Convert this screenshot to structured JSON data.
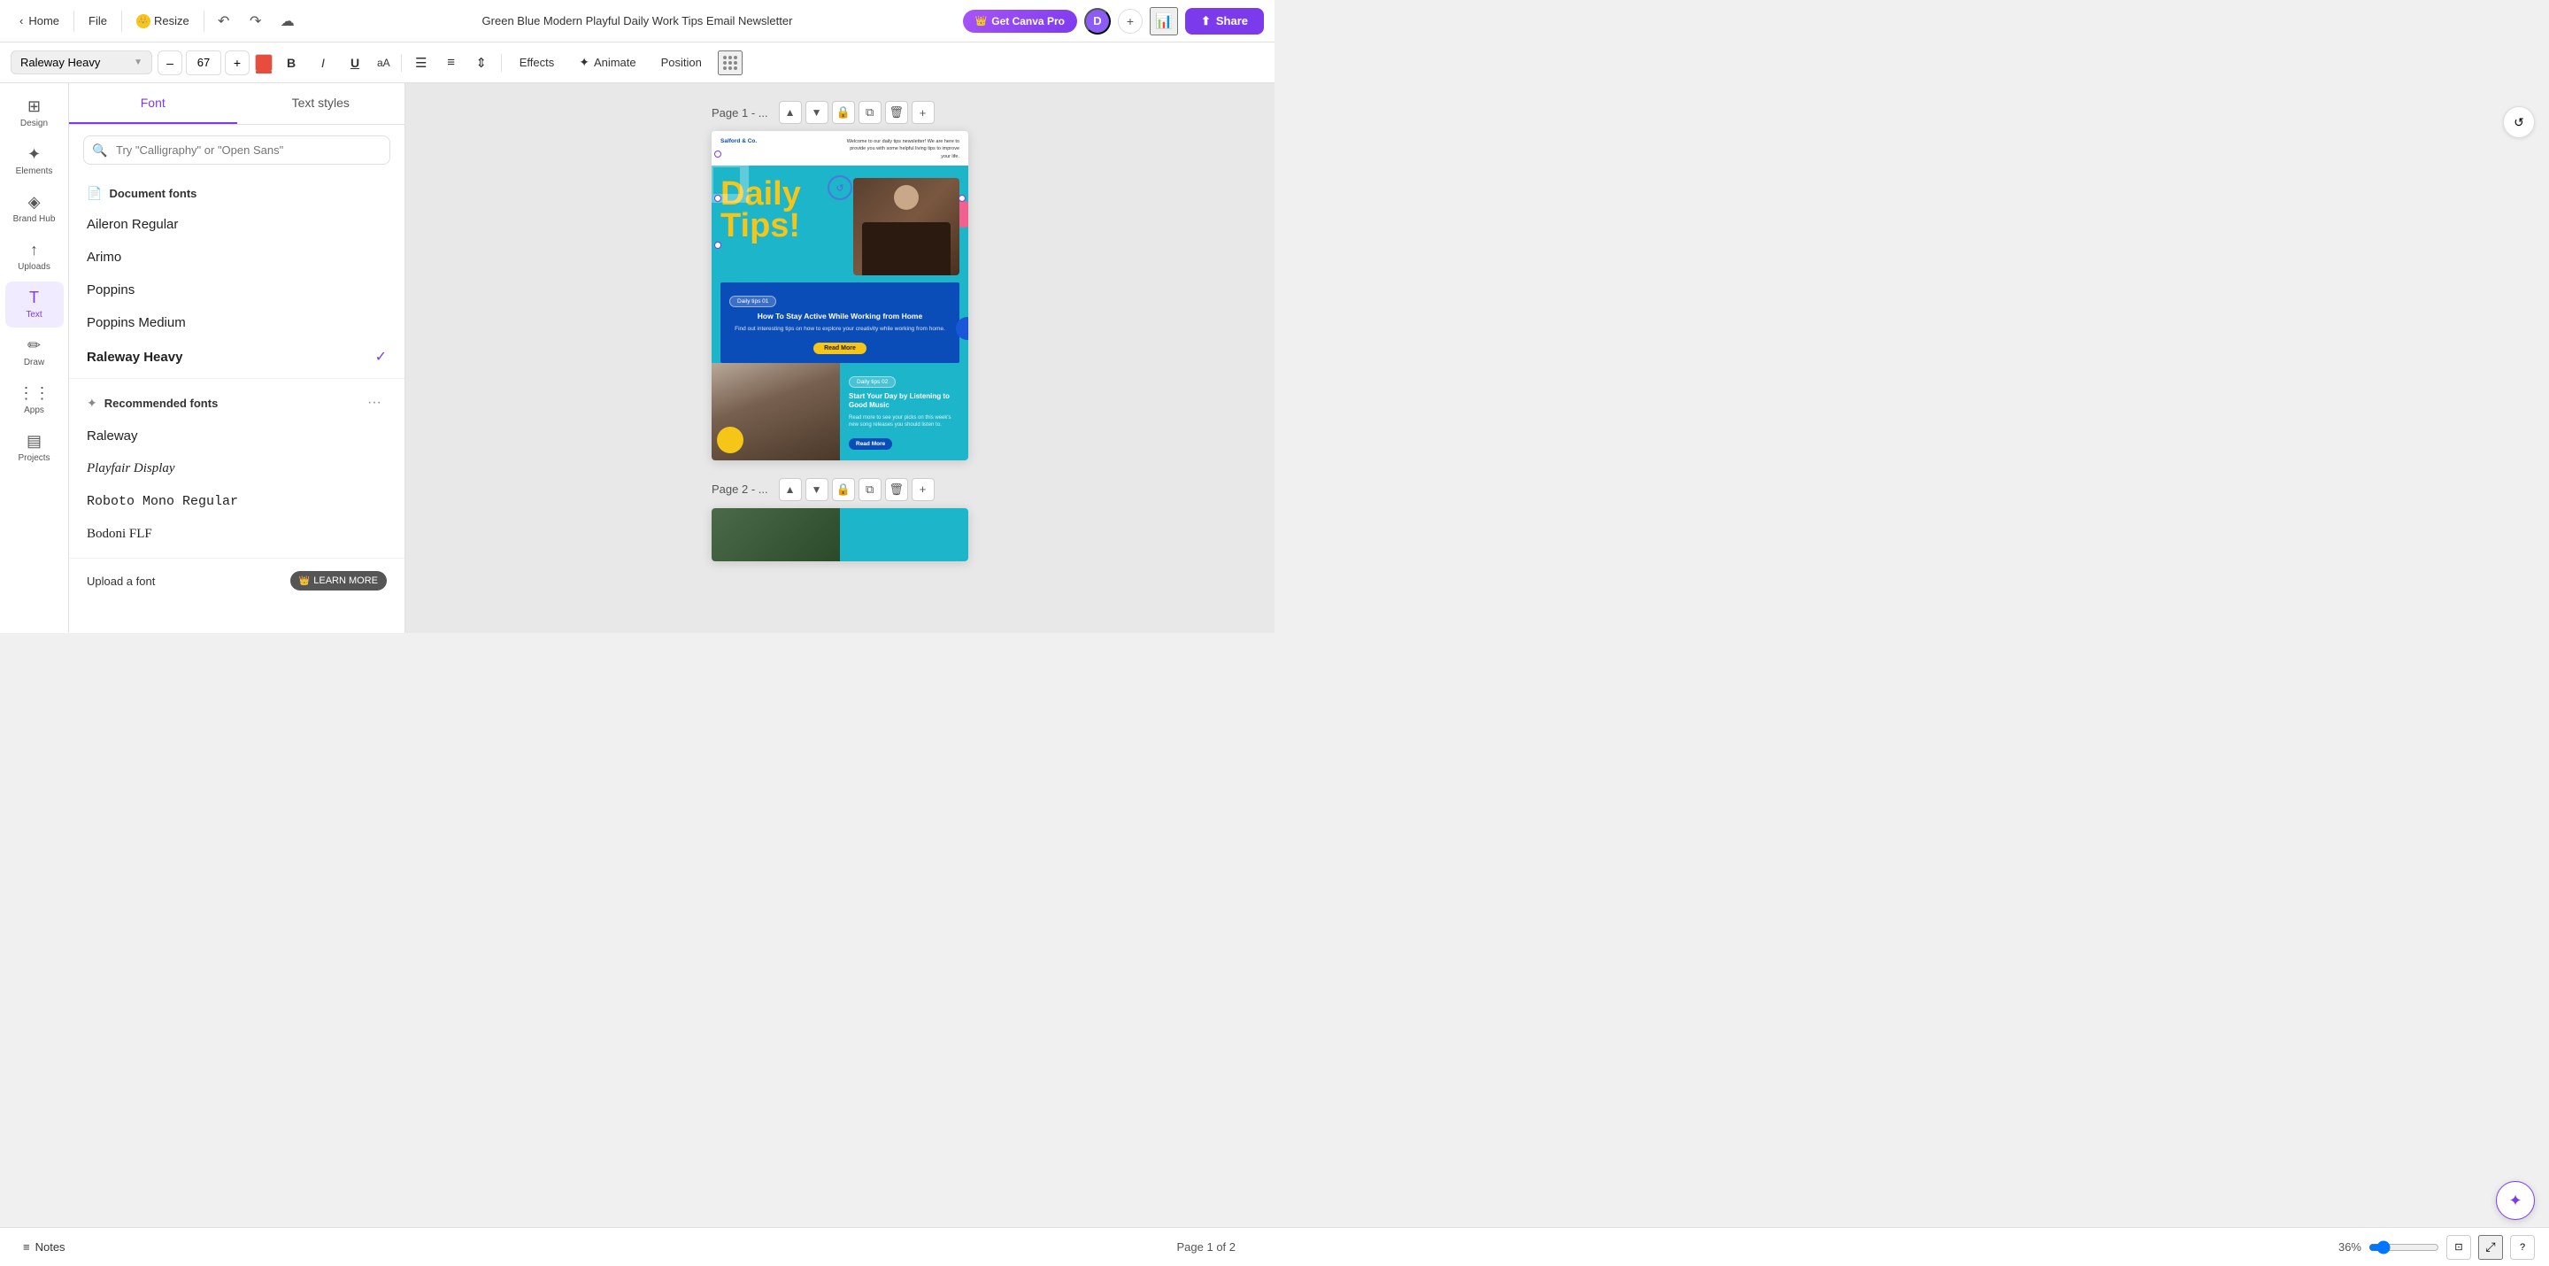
{
  "app": {
    "title": "Green Blue Modern Playful Daily Work Tips Email Newsletter"
  },
  "topbar": {
    "home_label": "Home",
    "file_label": "File",
    "resize_label": "Resize",
    "get_pro_label": "Get Canva Pro",
    "share_label": "Share",
    "avatar_letter": "D"
  },
  "toolbar": {
    "font_name": "Raleway Heavy",
    "font_size": "67",
    "effects_label": "Effects",
    "animate_label": "Animate",
    "position_label": "Position"
  },
  "font_panel": {
    "tab_font": "Font",
    "tab_text_styles": "Text styles",
    "search_placeholder": "Try \"Calligraphy\" or \"Open Sans\"",
    "document_fonts_label": "Document fonts",
    "document_fonts": [
      {
        "name": "Aileron Regular",
        "style": "normal",
        "selected": false
      },
      {
        "name": "Arimo",
        "style": "normal",
        "selected": false
      },
      {
        "name": "Poppins",
        "style": "normal",
        "selected": false
      },
      {
        "name": "Poppins Medium",
        "style": "normal",
        "selected": false
      },
      {
        "name": "Raleway Heavy",
        "style": "bold",
        "selected": true
      }
    ],
    "recommended_label": "Recommended fonts",
    "recommended_fonts": [
      {
        "name": "Raleway",
        "style": "normal"
      },
      {
        "name": "Playfair Display",
        "style": "normal"
      },
      {
        "name": "Roboto Mono Regular",
        "style": "monospace"
      },
      {
        "name": "Bodoni FLF",
        "style": "serif"
      }
    ],
    "upload_label": "Upload a font",
    "learn_more_label": "LEARN MORE"
  },
  "canvas": {
    "page1_label": "Page 1 - ...",
    "page2_label": "Page 2 - ...",
    "page_info": "Page 1 of 2",
    "zoom_level": "36%"
  },
  "sidebar": {
    "items": [
      {
        "id": "design",
        "label": "Design",
        "icon": "⊞"
      },
      {
        "id": "elements",
        "label": "Elements",
        "icon": "✦"
      },
      {
        "id": "brand-hub",
        "label": "Brand Hub",
        "icon": "◈"
      },
      {
        "id": "uploads",
        "label": "Uploads",
        "icon": "↑"
      },
      {
        "id": "text",
        "label": "Text",
        "icon": "T"
      },
      {
        "id": "draw",
        "label": "Draw",
        "icon": "✏"
      },
      {
        "id": "apps",
        "label": "Apps",
        "icon": "⋮⋮"
      },
      {
        "id": "projects",
        "label": "Projects",
        "icon": "▤"
      }
    ]
  },
  "newsletter": {
    "company": "Salford & Co.",
    "welcome_text": "Welcome to our daily tips newsletter! We are here to provide you with some helpful living tips to improve your life.",
    "daily_title": "Daily",
    "tips_title": "Tips!",
    "badge1": "Daily tips 01",
    "card1_title": "How To Stay Active While Working from Home",
    "card1_desc": "Find out interesting tips on how to explore your creativity while working from home.",
    "card1_btn": "Read More",
    "badge2": "Daily tips 02",
    "card2_title": "Start Your Day by Listening to Good Music",
    "card2_desc": "Read more to see your picks on this week's new song releases you should listen to.",
    "card2_btn": "Read More"
  },
  "bottombar": {
    "notes_label": "Notes",
    "page_info": "Page 1 of 2",
    "zoom_level": "36%"
  }
}
